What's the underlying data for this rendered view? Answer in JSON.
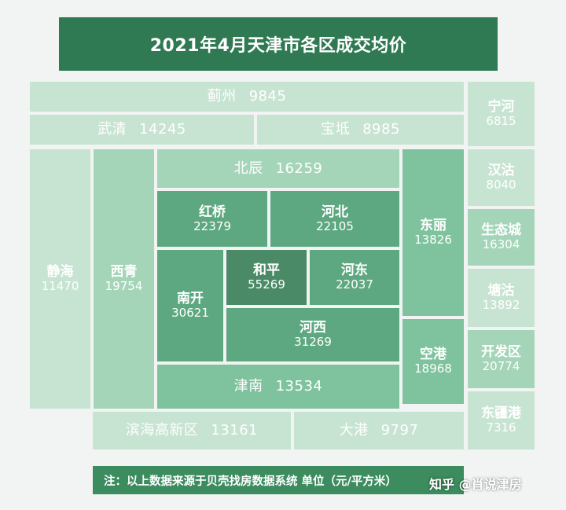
{
  "title": "2021年4月天津市各区成交均价",
  "districts": {
    "jizhou": {
      "name": "蓟州",
      "price": "9845"
    },
    "wuqing": {
      "name": "武清",
      "price": "14245"
    },
    "baodi": {
      "name": "宝坻",
      "price": "8985"
    },
    "ninghe": {
      "name": "宁河",
      "price": "6815"
    },
    "hangu": {
      "name": "汉沽",
      "price": "8040"
    },
    "shengtaicheng": {
      "name": "生态城",
      "price": "16304"
    },
    "tanggu": {
      "name": "塘沽",
      "price": "13892"
    },
    "kaifaqu": {
      "name": "开发区",
      "price": "20774"
    },
    "dongjianggang": {
      "name": "东疆港",
      "price": "7316"
    },
    "jinghai": {
      "name": "静海",
      "price": "11470"
    },
    "xiqing": {
      "name": "西青",
      "price": "19754"
    },
    "beichen": {
      "name": "北辰",
      "price": "16259"
    },
    "hongqiao": {
      "name": "红桥",
      "price": "22379"
    },
    "hebei": {
      "name": "河北",
      "price": "22105"
    },
    "nankai": {
      "name": "南开",
      "price": "30621"
    },
    "heping": {
      "name": "和平",
      "price": "55269"
    },
    "hedong": {
      "name": "河东",
      "price": "22037"
    },
    "hexi": {
      "name": "河西",
      "price": "31269"
    },
    "dongli": {
      "name": "东丽",
      "price": "13826"
    },
    "konggang": {
      "name": "空港",
      "price": "18968"
    },
    "jinnan": {
      "name": "津南",
      "price": "13534"
    },
    "binhaigaoxin": {
      "name": "滨海高新区",
      "price": "13161"
    },
    "dagang": {
      "name": "大港",
      "price": "9797"
    }
  },
  "note": "注：以上数据来源于贝壳找房数据系统 单位（元/平方米）",
  "watermark": "知乎 @肖说津房",
  "colors": {
    "title_bg": "#2f7a52",
    "note_bg": "#3c8c5f",
    "lightest": "#c7e4d2",
    "light": "#a5d5b8",
    "medium": "#7ec39d",
    "dark": "#5ea881",
    "darkest": "#4a8a66"
  }
}
